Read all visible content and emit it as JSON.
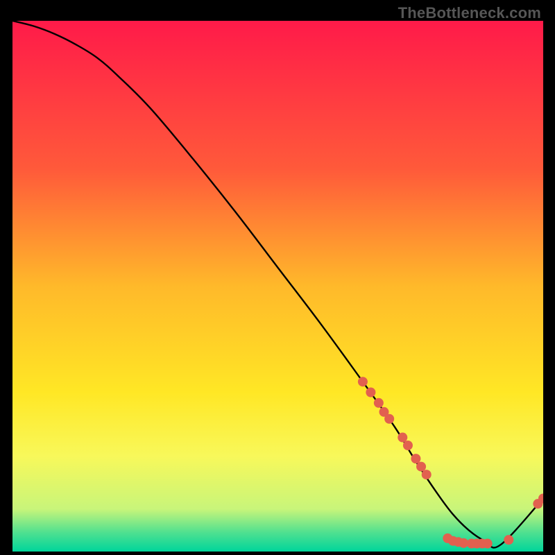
{
  "watermark": "TheBottleneck.com",
  "chart_data": {
    "type": "line",
    "title": "",
    "xlabel": "",
    "ylabel": "",
    "xlim": [
      0,
      100
    ],
    "ylim": [
      0,
      100
    ],
    "background_gradient": {
      "stops": [
        {
          "offset": 0.0,
          "color": "#ff1a49"
        },
        {
          "offset": 0.28,
          "color": "#ff5a3a"
        },
        {
          "offset": 0.5,
          "color": "#ffb92a"
        },
        {
          "offset": 0.7,
          "color": "#ffe725"
        },
        {
          "offset": 0.82,
          "color": "#f8f85a"
        },
        {
          "offset": 0.92,
          "color": "#c8f57a"
        },
        {
          "offset": 0.965,
          "color": "#4de090"
        },
        {
          "offset": 1.0,
          "color": "#00d59b"
        }
      ]
    },
    "series": [
      {
        "name": "bottleneck-curve",
        "stroke": "#000000",
        "x": [
          0,
          4,
          8,
          12,
          16,
          20,
          26,
          34,
          42,
          50,
          58,
          66,
          72,
          76,
          80,
          83,
          86,
          89,
          92,
          100
        ],
        "values": [
          100,
          99,
          97.5,
          95.5,
          93,
          89.5,
          83.5,
          74,
          64,
          53.5,
          43,
          32,
          23.5,
          17,
          11,
          7,
          4,
          2,
          1.3,
          10
        ]
      }
    ],
    "scatter": {
      "name": "sample-points",
      "color": "#e2604f",
      "radius": 7,
      "points": [
        {
          "x": 66.0,
          "y": 32.0
        },
        {
          "x": 67.5,
          "y": 30.0
        },
        {
          "x": 69.0,
          "y": 28.0
        },
        {
          "x": 70.0,
          "y": 26.3
        },
        {
          "x": 71.0,
          "y": 25.0
        },
        {
          "x": 73.5,
          "y": 21.5
        },
        {
          "x": 74.5,
          "y": 20.0
        },
        {
          "x": 76.0,
          "y": 17.5
        },
        {
          "x": 77.0,
          "y": 16.0
        },
        {
          "x": 78.0,
          "y": 14.5
        },
        {
          "x": 82.0,
          "y": 2.5
        },
        {
          "x": 83.0,
          "y": 2.0
        },
        {
          "x": 84.0,
          "y": 1.8
        },
        {
          "x": 85.0,
          "y": 1.6
        },
        {
          "x": 86.5,
          "y": 1.5
        },
        {
          "x": 87.5,
          "y": 1.5
        },
        {
          "x": 88.5,
          "y": 1.5
        },
        {
          "x": 89.5,
          "y": 1.5
        },
        {
          "x": 93.5,
          "y": 2.2
        },
        {
          "x": 99.0,
          "y": 9.0
        },
        {
          "x": 100.0,
          "y": 10.0
        }
      ]
    }
  }
}
